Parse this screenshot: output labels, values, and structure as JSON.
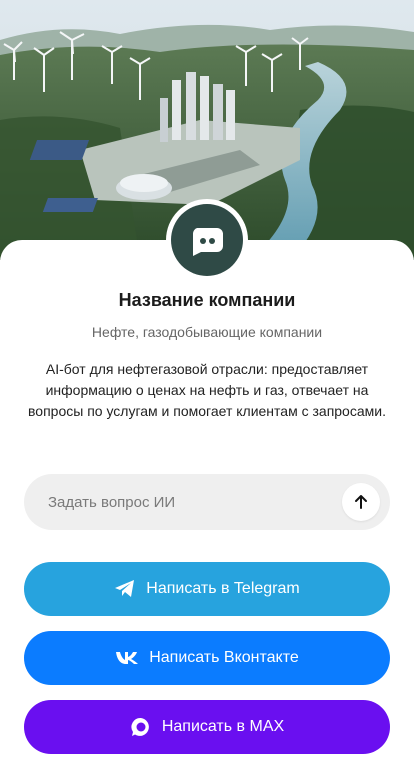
{
  "company": {
    "name": "Название компании",
    "category": "Нефте, газодобывающие компании",
    "description": "AI-бот для нефтегазовой отрасли: предоставляет информацию о ценах на нефть и газ, отвечает на вопросы по услугам и помогает клиентам с запросами."
  },
  "ask": {
    "placeholder": "Задать вопрос ИИ"
  },
  "buttons": {
    "telegram": {
      "label": "Написать в Telegram",
      "color": "#27a3de"
    },
    "vk": {
      "label": "Написать Вконтакте",
      "color": "#0b7cff"
    },
    "max": {
      "label": "Написать в MAX",
      "color": "#6a0ff0"
    }
  },
  "colors": {
    "avatar_bg": "#2f4a46",
    "input_bg": "#efefef"
  },
  "icons": {
    "avatar": "chat-bot-icon",
    "send": "arrow-up-icon",
    "telegram": "telegram-icon",
    "vk": "vk-icon",
    "max": "max-icon"
  }
}
